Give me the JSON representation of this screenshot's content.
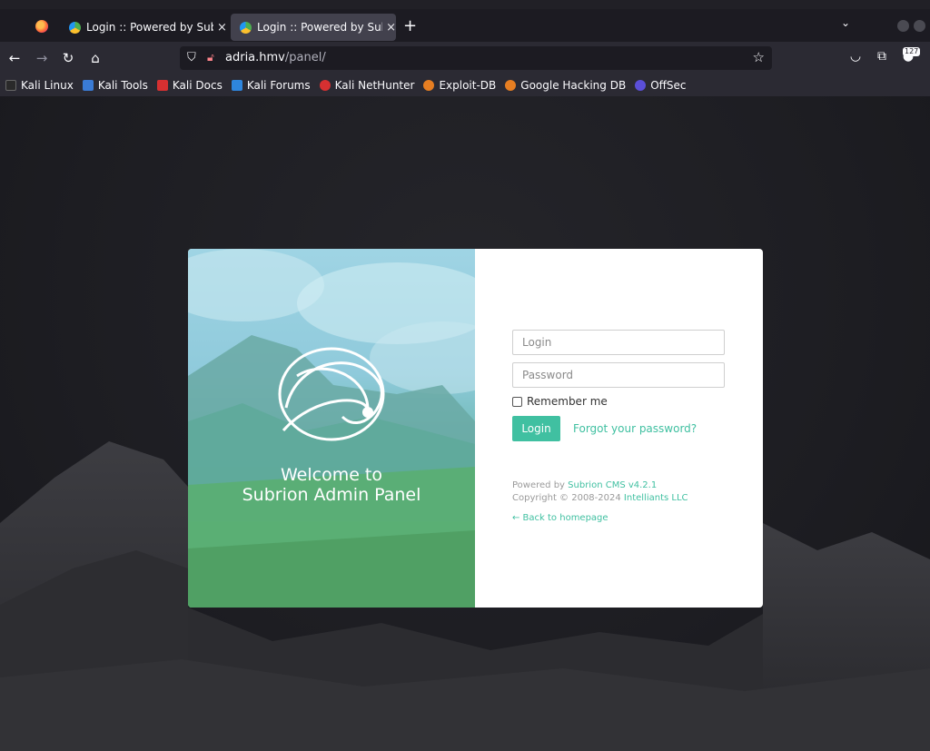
{
  "browser": {
    "tabs": [
      {
        "title": "Login :: Powered by Subrion CMS",
        "close": "×"
      },
      {
        "title": "Login :: Powered by Subrion CMS",
        "close": "×"
      }
    ],
    "new_tab": "+",
    "tab_list": "⌄",
    "url": {
      "host": "adria.hmv",
      "path": "/panel/"
    },
    "extension_badge": "127",
    "bookmarks": [
      {
        "label": "Kali Linux",
        "color": "#2a2a2a"
      },
      {
        "label": "Kali Tools",
        "color": "#3a7bd5"
      },
      {
        "label": "Kali Docs",
        "color": "#d63031"
      },
      {
        "label": "Kali Forums",
        "color": "#2e86de"
      },
      {
        "label": "Kali NetHunter",
        "color": "#d63031"
      },
      {
        "label": "Exploit-DB",
        "color": "#e67e22"
      },
      {
        "label": "Google Hacking DB",
        "color": "#e67e22"
      },
      {
        "label": "OffSec",
        "color": "#5b4fd8"
      }
    ]
  },
  "panel": {
    "welcome_line1": "Welcome to",
    "welcome_line2": "Subrion Admin Panel",
    "login_placeholder": "Login",
    "password_placeholder": "Password",
    "remember_label": "Remember me",
    "login_button": "Login",
    "forgot_link": "Forgot your password?",
    "powered_prefix": "Powered by",
    "powered_link": "Subrion CMS v4.2.1",
    "copyright_prefix": "Copyright © 2008-2024",
    "copyright_link": "Intelliants LLC",
    "back_link": "← Back to homepage",
    "accent_color": "#40c0a1"
  }
}
